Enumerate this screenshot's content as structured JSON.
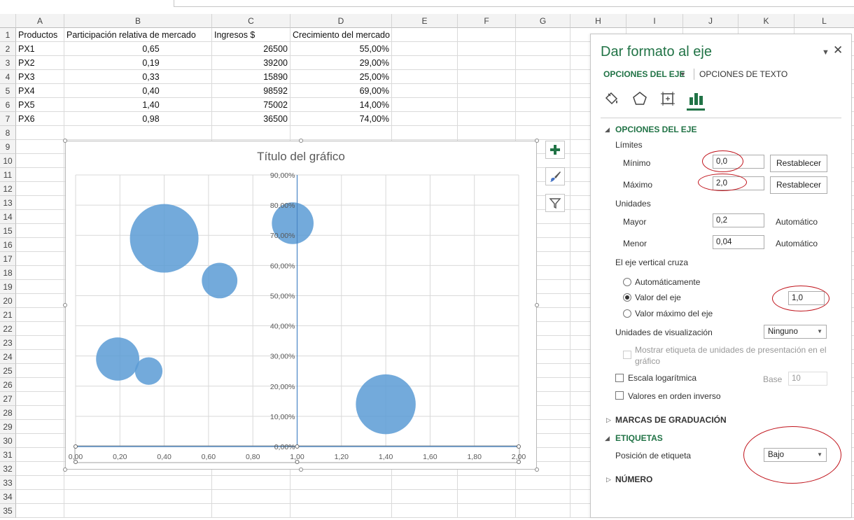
{
  "sheet": {
    "columns": [
      "A",
      "B",
      "C",
      "D",
      "E",
      "F",
      "G",
      "H",
      "I",
      "J",
      "K",
      "L"
    ],
    "rows": [
      "1",
      "2",
      "3",
      "4",
      "5",
      "6",
      "7",
      "8",
      "9",
      "10",
      "11",
      "12",
      "13",
      "14",
      "15",
      "16",
      "17",
      "18",
      "19",
      "20",
      "21",
      "22",
      "23",
      "24",
      "25",
      "26",
      "27",
      "28",
      "29",
      "30",
      "31",
      "32",
      "33",
      "34",
      "35"
    ],
    "headers": [
      "Productos",
      "Participación relativa de mercado",
      "Ingresos $",
      "Crecimiento del mercado %"
    ],
    "data": [
      [
        "PX1",
        "0,65",
        "26500",
        "55,00%"
      ],
      [
        "PX2",
        "0,19",
        "39200",
        "29,00%"
      ],
      [
        "PX3",
        "0,33",
        "15890",
        "25,00%"
      ],
      [
        "PX4",
        "0,40",
        "98592",
        "69,00%"
      ],
      [
        "PX5",
        "1,40",
        "75002",
        "14,00%"
      ],
      [
        "PX6",
        "0,98",
        "36500",
        "74,00%"
      ]
    ]
  },
  "chart_data": {
    "type": "bubble",
    "title": "Título del gráfico",
    "x": [
      0.65,
      0.19,
      0.33,
      0.4,
      1.4,
      0.98
    ],
    "y": [
      55,
      29,
      25,
      69,
      14,
      74
    ],
    "size": [
      26500,
      39200,
      15890,
      98592,
      75002,
      36500
    ],
    "xlim": [
      0,
      2
    ],
    "ylim": [
      0,
      90
    ],
    "x_ticks": [
      "0,00",
      "0,20",
      "0,40",
      "0,60",
      "0,80",
      "1,00",
      "1,20",
      "1,40",
      "1,60",
      "1,80",
      "2,00"
    ],
    "y_ticks": [
      "0,00%",
      "10,00%",
      "20,00%",
      "30,00%",
      "40,00%",
      "50,00%",
      "60,00%",
      "70,00%",
      "80,00%",
      "90,00%"
    ],
    "vertical_axis_crosses_at": 1.0,
    "grid": true,
    "bubble_color": "#5b9bd5"
  },
  "chart_buttons": [
    "add-chart-element-icon",
    "chart-styles-brush-icon",
    "chart-filter-icon"
  ],
  "pane": {
    "title": "Dar formato al eje",
    "tab_axis": "OPCIONES DEL EJE",
    "tab_text": "OPCIONES DE TEXTO",
    "icons": [
      "fill-line-icon",
      "effects-pentagon-icon",
      "size-properties-icon",
      "axis-options-bars-icon"
    ],
    "section_axis": "OPCIONES DEL EJE",
    "bounds_label": "Límites",
    "min_label": "Mínimo",
    "min_value": "0,0",
    "max_label": "Máximo",
    "max_value": "2,0",
    "reset": "Restablecer",
    "units_label": "Unidades",
    "major_label": "Mayor",
    "major_value": "0,2",
    "minor_label": "Menor",
    "minor_value": "0,04",
    "auto": "Automático",
    "cross_label": "El eje vertical cruza",
    "cross_auto": "Automáticamente",
    "cross_value_label": "Valor del eje",
    "cross_value": "1,0",
    "cross_max": "Valor máximo del eje",
    "display_units_label": "Unidades de visualización",
    "display_units_value": "Ninguno",
    "show_units_label": "Mostrar etiqueta de unidades de presentación en el gráfico",
    "log_label": "Escala logarítmica",
    "base_label": "Base",
    "base_value": "10",
    "reverse_label": "Valores en orden inverso",
    "section_ticks": "MARCAS DE GRADUACIÓN",
    "section_labels": "ETIQUETAS",
    "label_pos_label": "Posición de etiqueta",
    "label_pos_value": "Bajo",
    "section_number": "NÚMERO",
    "accent_color": "#217346",
    "annotation_color": "#c0141c"
  }
}
